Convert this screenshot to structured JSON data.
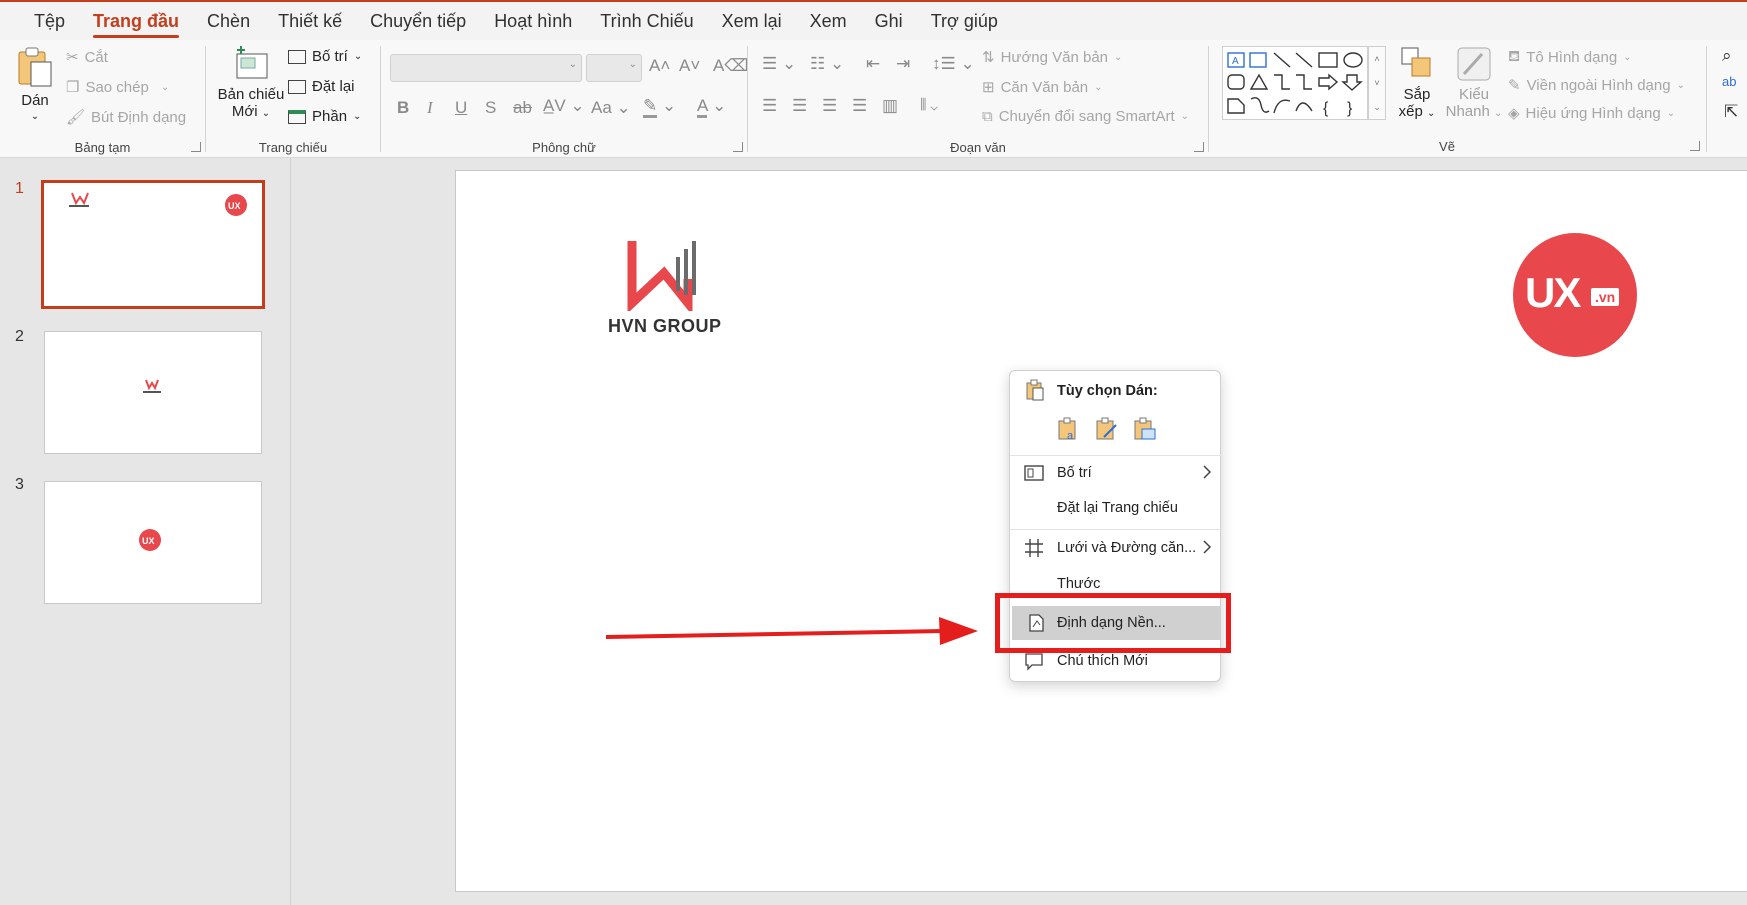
{
  "tabs": [
    "Tệp",
    "Trang đầu",
    "Chèn",
    "Thiết kế",
    "Chuyển tiếp",
    "Hoạt hình",
    "Trình Chiếu",
    "Xem lại",
    "Xem",
    "Ghi",
    "Trợ giúp"
  ],
  "ribbon": {
    "clipboard": {
      "label": "Bảng tạm",
      "paste": "Dán",
      "cut": "Cắt",
      "copy": "Sao chép",
      "format_painter": "Bút Định dạng"
    },
    "slides": {
      "label": "Trang chiếu",
      "new_slide_line1": "Bản chiếu",
      "new_slide_line2": "Mới",
      "layout": "Bố trí",
      "reset": "Đặt lại",
      "section": "Phần"
    },
    "font": {
      "label": "Phông chữ",
      "font_name": "",
      "font_size": ""
    },
    "paragraph": {
      "label": "Đoạn văn",
      "text_direction": "Hướng Văn bản",
      "align_text": "Căn Văn bản",
      "smartart": "Chuyển đổi sang SmartArt"
    },
    "drawing": {
      "label": "Vẽ",
      "arrange_line1": "Sắp",
      "arrange_line2": "xếp",
      "quick_styles_line1": "Kiểu",
      "quick_styles_line2": "Nhanh",
      "shape_fill": "Tô Hình dạng",
      "shape_outline": "Viền ngoài Hình dạng",
      "shape_effects": "Hiệu ứng Hình dạng"
    }
  },
  "thumbnails": [
    {
      "number": "1",
      "selected": true
    },
    {
      "number": "2",
      "selected": false
    },
    {
      "number": "3",
      "selected": false
    }
  ],
  "slide": {
    "left_logo_text": "HVN GROUP",
    "right_logo_main": "UX",
    "right_logo_suffix": ".vn"
  },
  "context_menu": {
    "paste_options_title": "Tùy chọn Dán:",
    "items": [
      {
        "label": "Bố trí",
        "has_submenu": true
      },
      {
        "label": "Đặt lại Trang chiếu",
        "has_submenu": false
      },
      {
        "label": "Lưới và Đường căn...",
        "has_submenu": true
      },
      {
        "label": "Thước",
        "has_submenu": false
      },
      {
        "label": "Định dạng Nền...",
        "has_submenu": false,
        "highlighted": true
      },
      {
        "label": "Chú thích Mới",
        "has_submenu": false
      }
    ]
  },
  "colors": {
    "accent": "#c43e1c",
    "annotation_red": "#e41d1d",
    "ux_logo_red": "#e8474b"
  }
}
